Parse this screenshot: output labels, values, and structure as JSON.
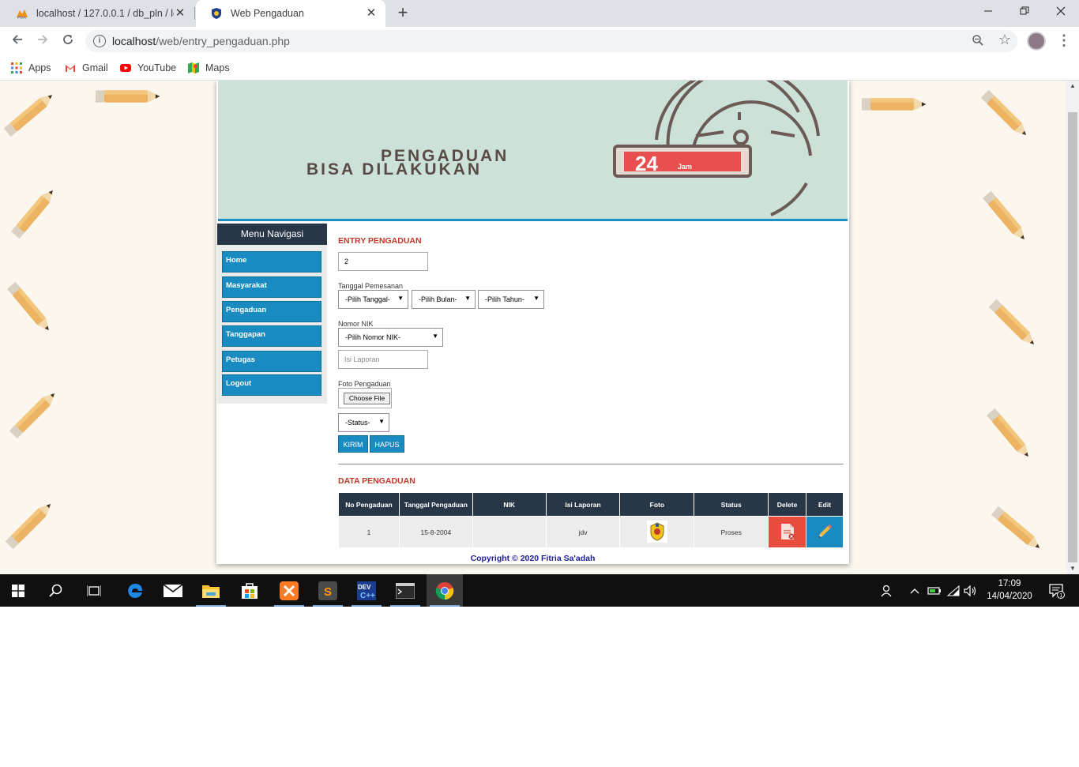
{
  "browser": {
    "tabs": [
      {
        "title": "localhost / 127.0.0.1 / db_pln / lo",
        "active": false,
        "icon": "phpmyadmin-icon"
      },
      {
        "title": "Web Pengaduan",
        "active": true,
        "icon": "site-shield-icon"
      }
    ],
    "close_glyph": "✕",
    "new_tab_glyph": "+",
    "url_host": "localhost",
    "url_path": "/web/entry_pengaduan.php",
    "bookmarks": [
      {
        "label": "Apps",
        "icon": "apps-grid-icon"
      },
      {
        "label": "Gmail",
        "icon": "gmail-icon"
      },
      {
        "label": "YouTube",
        "icon": "youtube-icon"
      },
      {
        "label": "Maps",
        "icon": "maps-icon"
      }
    ]
  },
  "banner": {
    "line1": "PENGADUAN",
    "line2": "BISA DILAKUKAN",
    "badge_number": "24",
    "badge_unit": "Jam"
  },
  "sidebar": {
    "title": "Menu Navigasi",
    "items": [
      "Home",
      "Masyarakat",
      "Pengaduan",
      "Tanggapan",
      "Petugas",
      "Logout"
    ]
  },
  "form": {
    "title": "ENTRY PENGADUAN",
    "id_value": "2",
    "date_label": "Tanggal Pemesanan",
    "day_select": "-Pilih Tanggal-",
    "month_select": "-Pilih Bulan-",
    "year_select": "-Pilih Tahun-",
    "nik_label": "Nomor NIK",
    "nik_select": "-Pilih Nomor NIK-",
    "report_placeholder": "Isi Laporan",
    "photo_label": "Foto Pengaduan",
    "file_button": "Choose File",
    "status_select": "-Status-",
    "submit_label": "KIRIM",
    "reset_label": "HAPUS"
  },
  "data_section": {
    "title": "DATA PENGADUAN",
    "columns": [
      "No Pengaduan",
      "Tanggal Pengaduan",
      "NIK",
      "Isi Laporan",
      "Foto",
      "Status",
      "Delete",
      "Edit"
    ],
    "rows": [
      {
        "no": "1",
        "tanggal": "15-8-2004",
        "nik": "",
        "isi": "jdv",
        "foto": "emblem-thumbnail",
        "status": "Proses"
      }
    ]
  },
  "footer": {
    "copyright": "Copyright © 2020 Fitria Sa'adah"
  },
  "taskbar": {
    "time": "17:09",
    "date": "14/04/2020",
    "notification_count": "1"
  },
  "colors": {
    "nav_blue": "#1a8bc0",
    "header_dark": "#283747",
    "title_red": "#c0392b",
    "delete_red": "#e74c3c",
    "footer_blue": "#1d1d9a",
    "banner_green": "#cce2d8"
  }
}
